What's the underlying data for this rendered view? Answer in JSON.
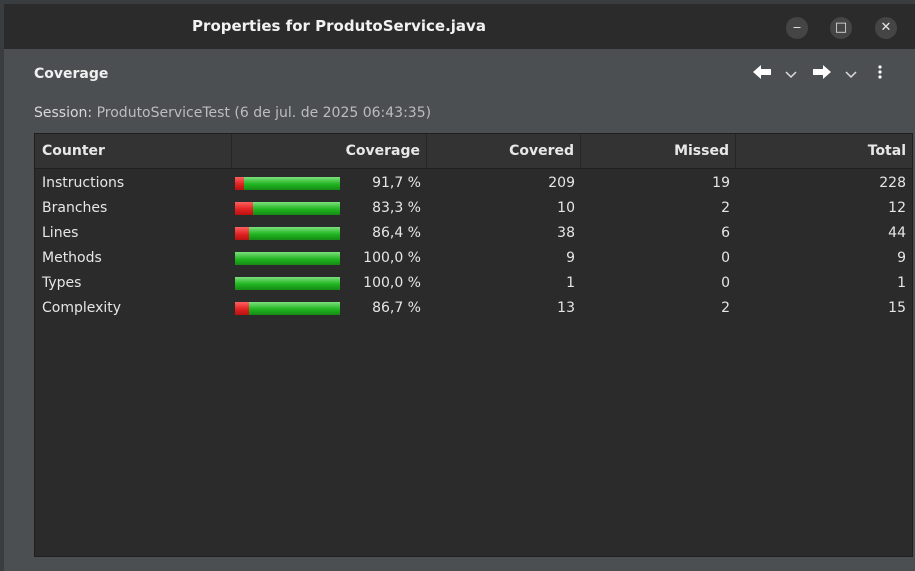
{
  "window": {
    "title": "Properties for ProdutoService.java",
    "controls": {
      "minimize": "‒",
      "maximize": "□",
      "close": "✕"
    }
  },
  "page": {
    "section_title": "Coverage",
    "nav": {
      "back_icon": "arrow-left-icon",
      "forward_icon": "arrow-right-icon",
      "menu_icon": "kebab-menu-icon"
    },
    "session_label": "Session:",
    "session_value": "ProdutoServiceTest (6 de jul. de 2025 06:43:35)"
  },
  "table": {
    "headers": {
      "counter": "Counter",
      "coverage": "Coverage",
      "covered": "Covered",
      "missed": "Missed",
      "total": "Total"
    },
    "rows": [
      {
        "counter": "Instructions",
        "coverage": "91,7 %",
        "coverage_fraction": 0.917,
        "covered": "209",
        "missed": "19",
        "total": "228"
      },
      {
        "counter": "Branches",
        "coverage": "83,3 %",
        "coverage_fraction": 0.833,
        "covered": "10",
        "missed": "2",
        "total": "12"
      },
      {
        "counter": "Lines",
        "coverage": "86,4 %",
        "coverage_fraction": 0.864,
        "covered": "38",
        "missed": "6",
        "total": "44"
      },
      {
        "counter": "Methods",
        "coverage": "100,0 %",
        "coverage_fraction": 1.0,
        "covered": "9",
        "missed": "0",
        "total": "9"
      },
      {
        "counter": "Types",
        "coverage": "100,0 %",
        "coverage_fraction": 1.0,
        "covered": "1",
        "missed": "0",
        "total": "1"
      },
      {
        "counter": "Complexity",
        "coverage": "86,7 %",
        "coverage_fraction": 0.867,
        "covered": "13",
        "missed": "2",
        "total": "15"
      }
    ]
  },
  "colors": {
    "covered_bar": "#21b521",
    "missed_bar": "#e02222"
  }
}
